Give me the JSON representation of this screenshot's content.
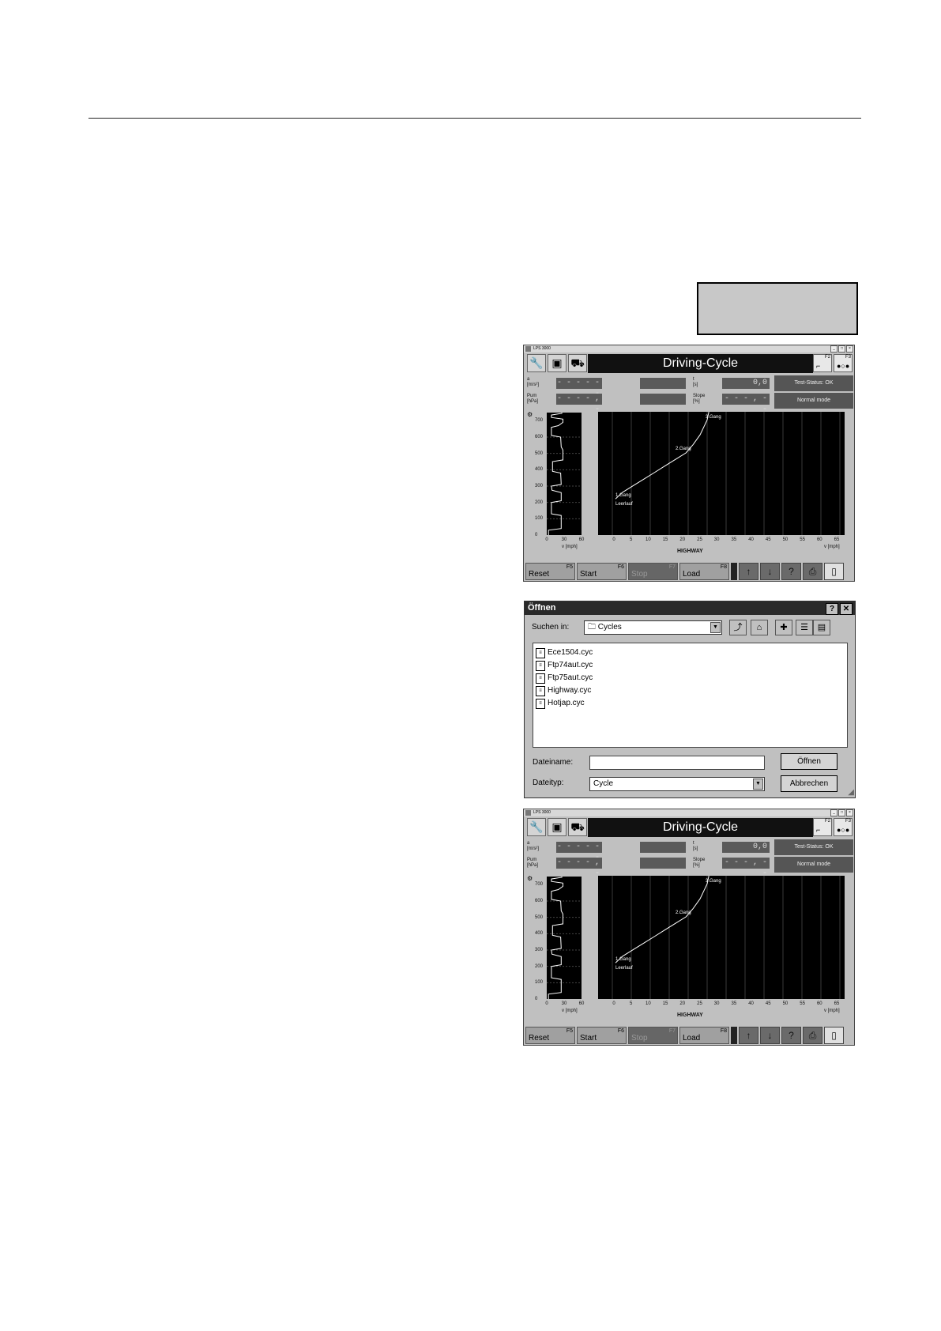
{
  "app": {
    "window_title": "LPS 3000",
    "header_title": "Driving-Cycle",
    "fkeys": [
      {
        "key": "F2",
        "icon": "car-side-icon"
      },
      {
        "key": "F3",
        "icon": "wheels-icon"
      }
    ],
    "params": {
      "a_label": "a",
      "a_unit": "[m/s²]",
      "pum_label": "Pum",
      "pum_unit": "[hPa]",
      "t_label": "t",
      "t_unit": "[s]",
      "slope_label": "Slope",
      "slope_unit": "[%]",
      "a_value": "- - - - - -",
      "pum_value": "- - - - , -",
      "t_value": "0,0",
      "slope_value": "- - - , - -"
    },
    "status": {
      "test_status": "Test-Status: OK",
      "mode": "Normal mode"
    },
    "small_plot": {
      "y_ticks": [
        "700",
        "600",
        "500",
        "400",
        "300",
        "200",
        "100",
        "0"
      ],
      "x_ticks": [
        "0",
        "30",
        "60"
      ],
      "x_label": "v [mph]"
    },
    "big_plot": {
      "x_ticks": [
        "0",
        "5",
        "10",
        "15",
        "20",
        "25",
        "30",
        "35",
        "40",
        "45",
        "50",
        "55",
        "60",
        "65"
      ],
      "x_label": "v [mph]",
      "cycle_name": "HIGHWAY",
      "annotations": [
        "3.Gang",
        "2.Gang",
        "1.Gang",
        "Leerlauf"
      ]
    },
    "buttons": [
      {
        "label": "Reset",
        "key": "F5"
      },
      {
        "label": "Start",
        "key": "F6"
      },
      {
        "label": "Stop",
        "key": "F7"
      },
      {
        "label": "Load",
        "key": "F8"
      }
    ]
  },
  "chart_data": [
    {
      "type": "line",
      "title": "",
      "xlabel": "v [mph]",
      "ylabel": "",
      "xlim": [
        0,
        60
      ],
      "ylim": [
        0,
        750
      ],
      "series": [
        {
          "x": [
            3,
            3,
            25,
            25,
            8,
            8,
            25,
            25,
            9,
            8,
            25,
            24,
            10,
            10,
            28,
            28,
            25,
            24,
            8,
            8,
            20,
            28,
            28,
            8,
            8,
            26,
            26
          ],
          "y": [
            0,
            30,
            40,
            120,
            130,
            200,
            210,
            260,
            275,
            300,
            310,
            380,
            390,
            450,
            460,
            520,
            540,
            600,
            610,
            660,
            670,
            690,
            710,
            720,
            735,
            745,
            750
          ]
        }
      ]
    },
    {
      "type": "line",
      "title": "HIGHWAY",
      "xlabel": "v [mph]",
      "ylabel": "",
      "xlim": [
        0,
        65
      ],
      "ylim": [
        0,
        750
      ],
      "series": [
        {
          "x": [
            0,
            2,
            5,
            8,
            11,
            14,
            17,
            20,
            22,
            24,
            26,
            26.5
          ],
          "y": [
            220,
            260,
            300,
            340,
            380,
            420,
            460,
            500,
            550,
            610,
            700,
            760
          ]
        }
      ]
    }
  ],
  "dialog": {
    "title": "Öffnen",
    "help": "?",
    "close": "✕",
    "look_in_label": "Suchen in:",
    "look_in_value": "Cycles",
    "files": [
      "Ece1504.cyc",
      "Ftp74aut.cyc",
      "Ftp75aut.cyc",
      "Highway.cyc",
      "Hotjap.cyc"
    ],
    "filename_label": "Dateiname:",
    "filename_value": "",
    "filetype_label": "Dateityp:",
    "filetype_value": "Cycle",
    "open_button": "Öffnen",
    "cancel_button": "Abbrechen"
  }
}
